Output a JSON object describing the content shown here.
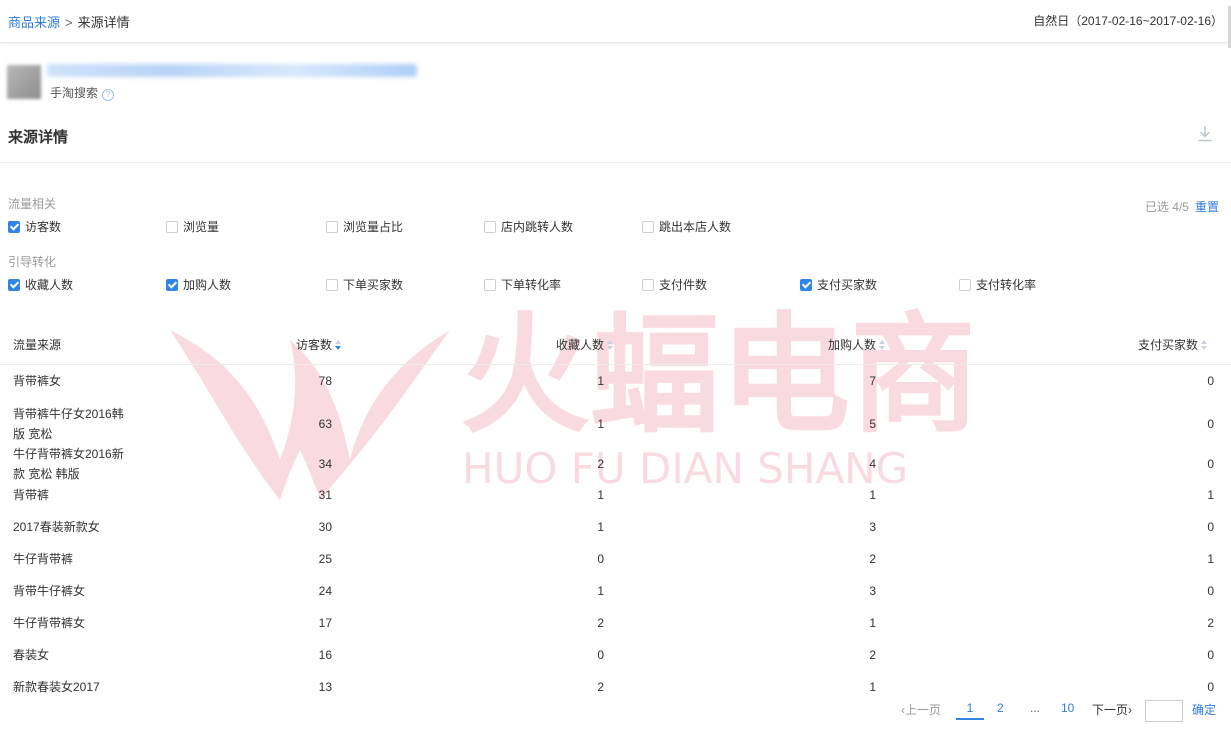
{
  "breadcrumb": {
    "parent": "商品来源",
    "separator": ">",
    "current": "来源详情"
  },
  "date_range": "自然日（2017-02-16~2017-02-16）",
  "source": {
    "subtitle": "手淘搜索",
    "help": "?"
  },
  "section": {
    "title": "来源详情"
  },
  "filters": {
    "traffic_label": "流量相关",
    "traffic": [
      {
        "label": "访客数",
        "checked": true
      },
      {
        "label": "浏览量",
        "checked": false
      },
      {
        "label": "浏览量占比",
        "checked": false
      },
      {
        "label": "店内跳转人数",
        "checked": false
      },
      {
        "label": "跳出本店人数",
        "checked": false
      }
    ],
    "conversion_label": "引导转化",
    "conversion": [
      {
        "label": "收藏人数",
        "checked": true
      },
      {
        "label": "加购人数",
        "checked": true
      },
      {
        "label": "下单买家数",
        "checked": false
      },
      {
        "label": "下单转化率",
        "checked": false
      },
      {
        "label": "支付件数",
        "checked": false
      },
      {
        "label": "支付买家数",
        "checked": true
      },
      {
        "label": "支付转化率",
        "checked": false
      }
    ],
    "selected_text": "已选 4/5",
    "reset_label": "重置"
  },
  "table": {
    "headers": [
      "流量来源",
      "访客数",
      "收藏人数",
      "加购人数",
      "支付买家数"
    ],
    "rows": [
      {
        "source": "背带裤女",
        "visitors": "78",
        "fav": "1",
        "cart": "7",
        "buyers": "0"
      },
      {
        "source": "背带裤牛仔女2016韩版 宽松",
        "visitors": "63",
        "fav": "1",
        "cart": "5",
        "buyers": "0"
      },
      {
        "source": "牛仔背带裤女2016新款 宽松 韩版",
        "visitors": "34",
        "fav": "2",
        "cart": "4",
        "buyers": "0"
      },
      {
        "source": "背带裤",
        "visitors": "31",
        "fav": "1",
        "cart": "1",
        "buyers": "1"
      },
      {
        "source": "2017春装新款女",
        "visitors": "30",
        "fav": "1",
        "cart": "3",
        "buyers": "0"
      },
      {
        "source": "牛仔背带裤",
        "visitors": "25",
        "fav": "0",
        "cart": "2",
        "buyers": "1"
      },
      {
        "source": "背带牛仔裤女",
        "visitors": "24",
        "fav": "1",
        "cart": "3",
        "buyers": "0"
      },
      {
        "source": "牛仔背带裤女",
        "visitors": "17",
        "fav": "2",
        "cart": "1",
        "buyers": "2"
      },
      {
        "source": "春装女",
        "visitors": "16",
        "fav": "0",
        "cart": "2",
        "buyers": "0"
      },
      {
        "source": "新款春装女2017",
        "visitors": "13",
        "fav": "2",
        "cart": "1",
        "buyers": "0"
      }
    ]
  },
  "pagination": {
    "prev": "上一页",
    "pages": [
      "1",
      "2",
      "...",
      "10"
    ],
    "current": "1",
    "next": "下一页",
    "jump_value": "",
    "confirm": "确定"
  },
  "watermark": {
    "brand": "火蝠电商",
    "pinyin": "HUO FU DIAN SHANG",
    "color": "#e23a5a"
  }
}
